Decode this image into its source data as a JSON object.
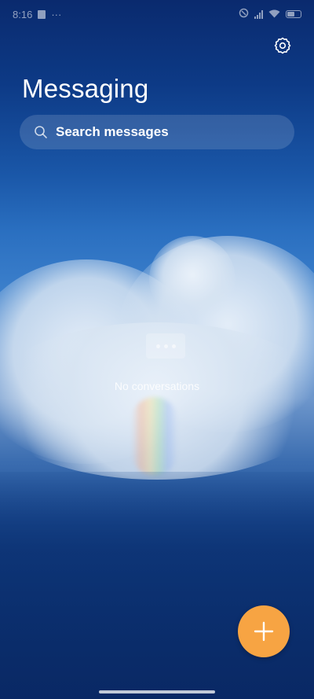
{
  "status_bar": {
    "time": "8:16",
    "more_dots": "···",
    "icons": [
      "notification-square-icon",
      "nfc-icon",
      "signal-icon",
      "wifi-icon",
      "battery-icon"
    ]
  },
  "header": {
    "title": "Messaging",
    "settings_icon": "gear-icon"
  },
  "search": {
    "placeholder": "Search messages",
    "icon": "search-icon"
  },
  "empty_state": {
    "icon": "chat-dots-icon",
    "text": "No conversations"
  },
  "fab": {
    "icon": "plus-icon",
    "color": "#f7a443"
  },
  "colors": {
    "title_text": "#ffffff",
    "background_top": "#0a2a6e",
    "background_bottom": "#0a2e6a"
  }
}
